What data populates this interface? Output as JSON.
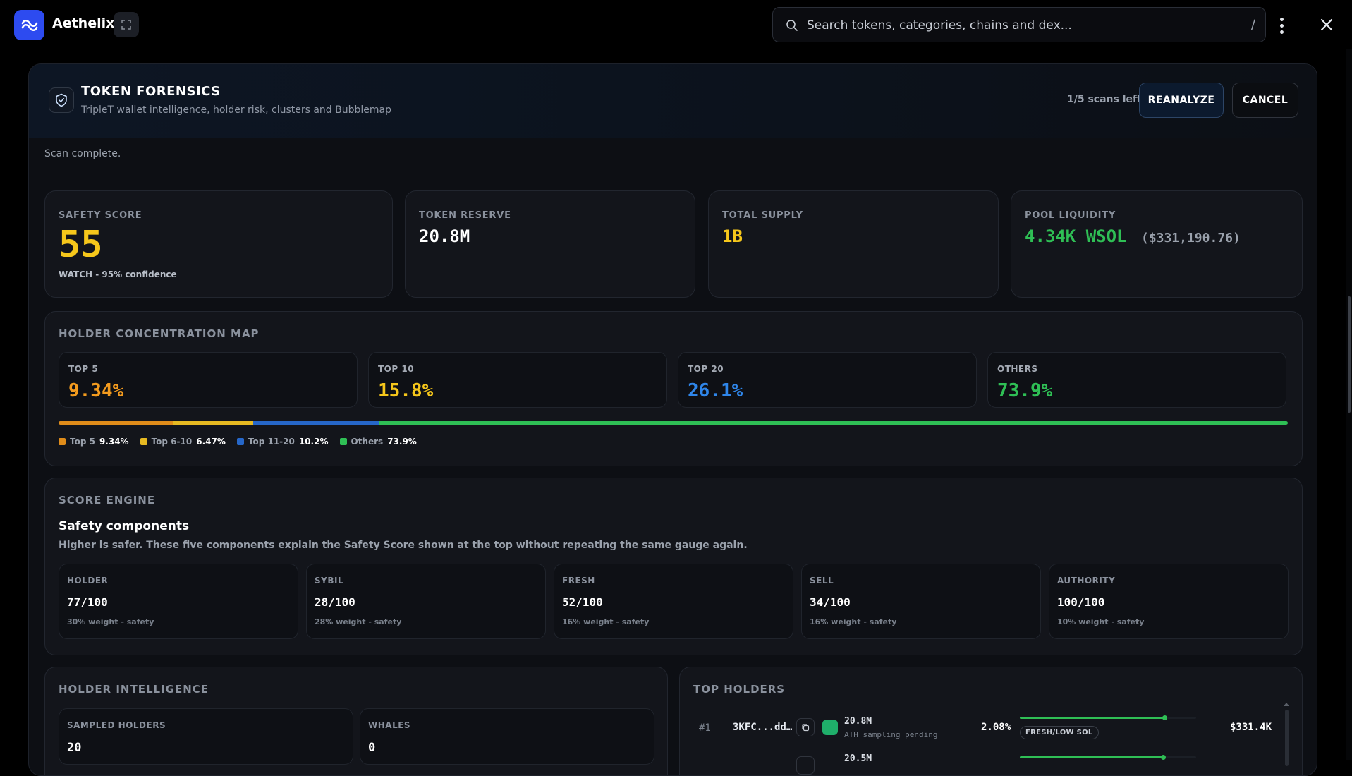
{
  "app": {
    "name": "Aethelix"
  },
  "search": {
    "placeholder": "Search tokens, categories, chains and dex...",
    "shortcut": "/"
  },
  "header": {
    "title": "TOKEN FORENSICS",
    "subtitle": "TripleT wallet intelligence, holder risk, clusters and Bubblemap",
    "scans_left": "1/5 scans left",
    "reanalyze_label": "REANALYZE",
    "cancel_label": "CANCEL"
  },
  "status": {
    "text": "Scan complete."
  },
  "stats": {
    "safety": {
      "label": "SAFETY SCORE",
      "value": "55",
      "sub": "WATCH - 95% confidence"
    },
    "reserve": {
      "label": "TOKEN RESERVE",
      "value": "20.8M"
    },
    "supply": {
      "label": "TOTAL SUPPLY",
      "value": "1B"
    },
    "liquidity": {
      "label": "POOL LIQUIDITY",
      "value": "4.34K WSOL",
      "usd": "($331,190.76)"
    }
  },
  "concentration": {
    "title": "HOLDER CONCENTRATION MAP",
    "boxes": [
      {
        "label": "TOP 5",
        "value": "9.34%",
        "color": "#f39b1e"
      },
      {
        "label": "TOP 10",
        "value": "15.8%",
        "color": "#f6c71b"
      },
      {
        "label": "TOP 20",
        "value": "26.1%",
        "color": "#2f86ea"
      },
      {
        "label": "OTHERS",
        "value": "73.9%",
        "color": "#2fbf55"
      }
    ],
    "bar": [
      {
        "name": "Top 5",
        "value": "9.34%",
        "fraction": 0.0934,
        "color": "#e08c1a"
      },
      {
        "name": "Top 6-10",
        "value": "6.47%",
        "fraction": 0.0647,
        "color": "#e6b922"
      },
      {
        "name": "Top 11-20",
        "value": "10.2%",
        "fraction": 0.102,
        "color": "#2667c9"
      },
      {
        "name": "Others",
        "value": "73.9%",
        "fraction": 0.739,
        "color": "#2fbf55"
      }
    ]
  },
  "score_engine": {
    "title": "SCORE ENGINE",
    "heading": "Safety components",
    "description": "Higher is safer. These five components explain the Safety Score shown at the top without repeating the same gauge again.",
    "components": [
      {
        "label": "HOLDER",
        "value": "77/100",
        "weight": "30% weight - safety"
      },
      {
        "label": "SYBIL",
        "value": "28/100",
        "weight": "28% weight - safety"
      },
      {
        "label": "FRESH",
        "value": "52/100",
        "weight": "16% weight - safety"
      },
      {
        "label": "SELL",
        "value": "34/100",
        "weight": "16% weight - safety"
      },
      {
        "label": "AUTHORITY",
        "value": "100/100",
        "weight": "10% weight - safety"
      }
    ]
  },
  "holder_intelligence": {
    "title": "HOLDER INTELLIGENCE",
    "boxes": [
      {
        "label": "SAMPLED HOLDERS",
        "value": "20"
      },
      {
        "label": "WHALES",
        "value": "0"
      }
    ]
  },
  "top_holders": {
    "title": "TOP HOLDERS",
    "rows": [
      {
        "rank": "#1",
        "address": "3KFC...dd…",
        "amount": "20.8M",
        "note": "ATH sampling pending",
        "pct": "2.08%",
        "bar_fraction": 0.82,
        "tag": "FRESH/LOW SOL",
        "usd": "$331.4K"
      },
      {
        "rank": "",
        "address": "",
        "amount": "20.5M",
        "note": "",
        "pct": "",
        "bar_fraction": 0.81,
        "tag": "",
        "usd": ""
      }
    ]
  }
}
